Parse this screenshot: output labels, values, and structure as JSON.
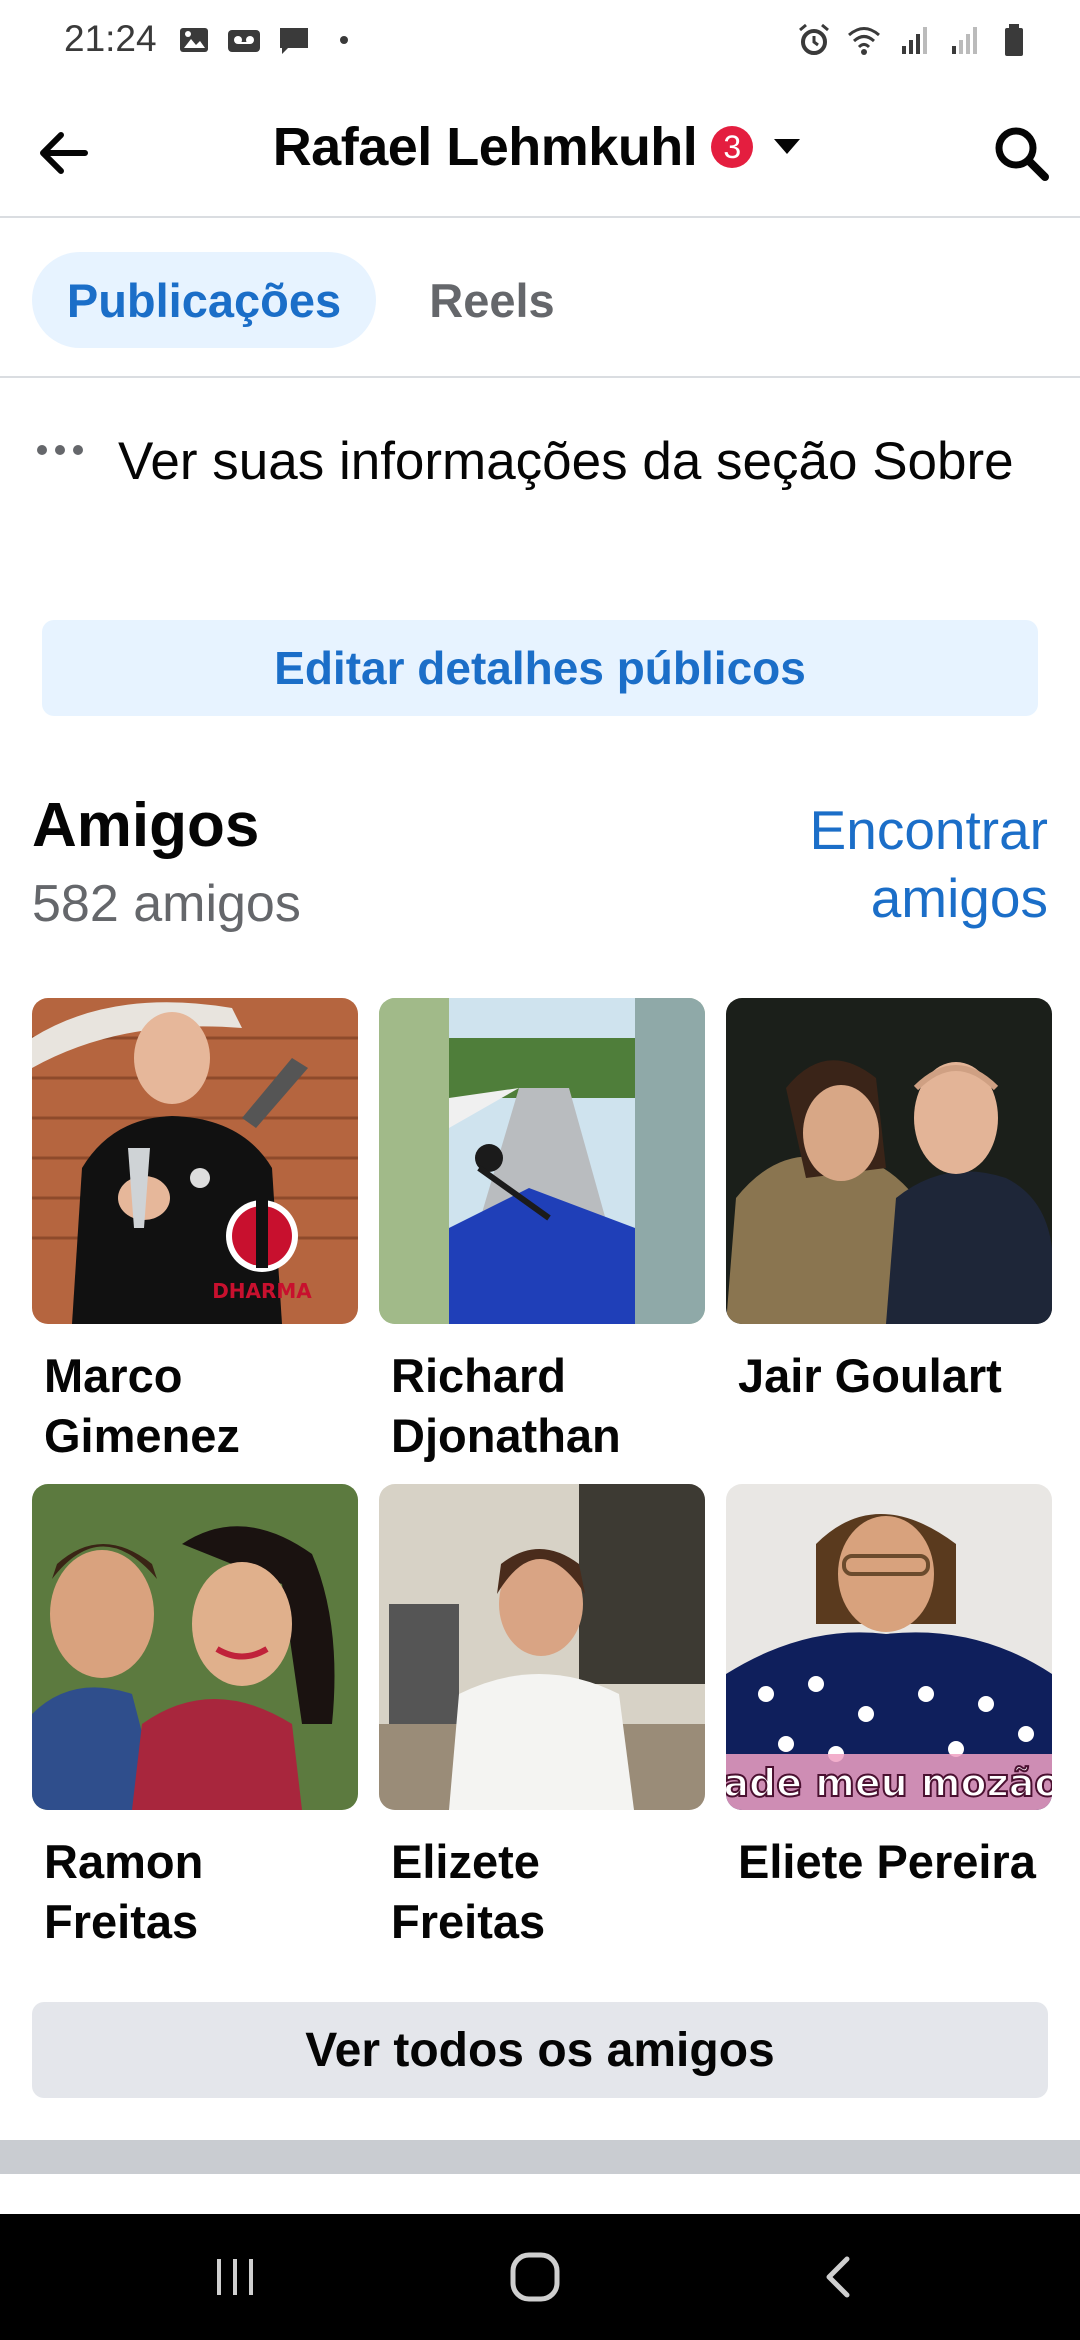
{
  "status_bar": {
    "time": "21:24",
    "left_icons": [
      "image-icon",
      "voicemail-icon",
      "chat-icon",
      "dot-icon"
    ],
    "right_icons": [
      "alarm-icon",
      "wifi-icon",
      "signal-icon",
      "signal-icon",
      "battery-icon"
    ]
  },
  "header": {
    "title": "Rafael Lehmkuhl",
    "badge_count": "3",
    "back_icon": "back-arrow-icon",
    "search_icon": "search-icon"
  },
  "tabs": [
    {
      "label": "Publicações",
      "active": true
    },
    {
      "label": "Reels",
      "active": false
    }
  ],
  "about": {
    "text": "Ver suas informações da seção Sobre",
    "icon": "more-dots-icon"
  },
  "edit_public_details_label": "Editar detalhes públicos",
  "friends": {
    "title": "Amigos",
    "count_text": "582 amigos",
    "find_friends_label": "Encontrar amigos",
    "items": [
      {
        "name": "Marco Gimenez"
      },
      {
        "name": "Richard Djonathan"
      },
      {
        "name": "Jair Goulart"
      },
      {
        "name": "Ramon Freitas"
      },
      {
        "name": "Elizete Freitas"
      },
      {
        "name": "Eliete Pereira"
      }
    ],
    "photo_captions": {
      "marco_logo": "DHARMA",
      "eliete_overlay": "Cade meu mozão?"
    },
    "see_all_label": "Ver todos os amigos"
  },
  "nav_bar": {
    "icons": [
      "recent-apps-icon",
      "home-icon",
      "back-icon"
    ]
  },
  "colors": {
    "accent": "#1b6ec8",
    "accent_bg": "#e7f3ff",
    "badge": "#e41e3f",
    "secondary_text": "#65676b"
  }
}
